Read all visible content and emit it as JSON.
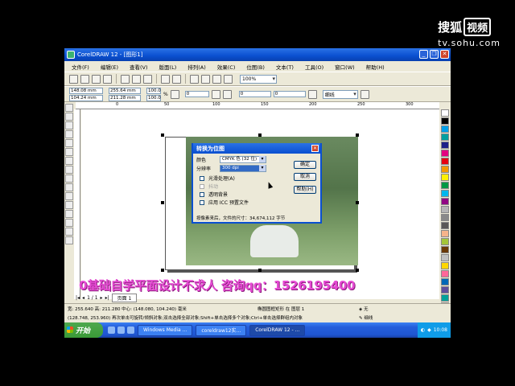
{
  "watermark": {
    "brand": "搜狐",
    "brand_box": "视频",
    "url": "tv.sohu.com"
  },
  "app": {
    "title": "CorelDRAW 12 - [图形1]",
    "menus": [
      "文件(F)",
      "编辑(E)",
      "查看(V)",
      "版面(L)",
      "排列(A)",
      "效果(C)",
      "位图(B)",
      "文本(T)",
      "工具(O)",
      "窗口(W)",
      "帮助(H)"
    ],
    "zoom": "100%",
    "props": {
      "x": "148.08 mm",
      "y": "104.24 mm",
      "w": "255.64 mm",
      "h": "211.28 mm",
      "scale_x": "100.0",
      "scale_y": "100.0",
      "unit": "%",
      "angle": "0",
      "outline": "细线",
      "nudge1": "0",
      "nudge2": "0"
    },
    "ruler_ticks": [
      "0",
      "50",
      "100",
      "150",
      "200",
      "250",
      "300"
    ]
  },
  "dialog": {
    "title": "转换为位图",
    "color_label": "颜色",
    "color_value": "CMYK 色 (32 位)",
    "resolution_label": "分辨率",
    "resolution_value": "300 dpi",
    "opt_antialias": "光滑处理(A)",
    "opt_dither": "抖动",
    "opt_transparent": "透明背景",
    "opt_icc": "应用 ICC 预置文件",
    "note": "按像素来后，文件的尺寸：34,674,112 字节",
    "ok": "确定",
    "cancel": "取消",
    "help": "帮助(H)"
  },
  "overlay": "0基础自学平面设计不求人 咨询qq：1526195400",
  "pager": {
    "count": "1 / 1",
    "tab": "页面 1"
  },
  "status": {
    "line1": "宽: 255.640 高: 211.280 中心: (148.080, 104.240) 毫米",
    "line2": "(128.748, 253.960)  再次单击可旋转/倾斜对象;双击选择全部对象;Shift+单击选择多个对象;Ctrl+单击选择群组内对象",
    "mid": "椭圆图框矩形 在 图层 1",
    "fill": "无",
    "outline": "细线"
  },
  "taskbar": {
    "start": "开始",
    "tasks": [
      "Windows Media ...",
      "coreldraw12实...",
      "CorelDRAW 12 - ..."
    ],
    "clock": "10:08"
  },
  "palette_colors": [
    "#ffffff",
    "#000000",
    "#00a0e9",
    "#00a0a0",
    "#1d2088",
    "#e4007f",
    "#e60012",
    "#f39800",
    "#fff100",
    "#009944",
    "#00b7ee",
    "#920783",
    "#b5b5b6",
    "#898989",
    "#595757",
    "#f6b38a",
    "#a4c639",
    "#6a3906",
    "#c0c0c0",
    "#ffd700",
    "#ff6699",
    "#0068b7",
    "#5f4f9e",
    "#00a29a",
    "#e5004f"
  ]
}
